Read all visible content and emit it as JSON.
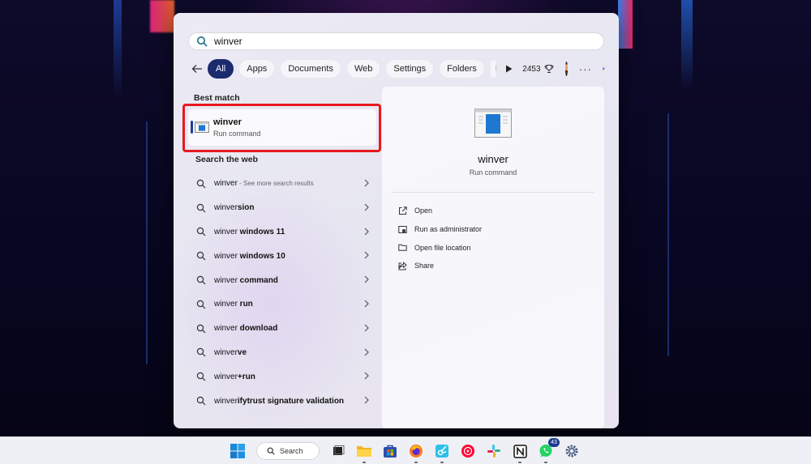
{
  "search": {
    "query": "winver"
  },
  "filters": {
    "tabs": [
      {
        "label": "All",
        "active": true
      },
      {
        "label": "Apps"
      },
      {
        "label": "Documents"
      },
      {
        "label": "Web"
      },
      {
        "label": "Settings"
      },
      {
        "label": "Folders"
      },
      {
        "label": "P"
      }
    ],
    "points": "2453"
  },
  "left": {
    "best_match_title": "Best match",
    "best_match": {
      "name": "winver",
      "subtitle": "Run command"
    },
    "web_title": "Search the web",
    "web_results": [
      {
        "prefix": "winver",
        "bold": "",
        "hint": " - See more search results"
      },
      {
        "prefix": "winver",
        "bold": "sion",
        "hint": ""
      },
      {
        "prefix": "winver",
        "bold": " windows 11",
        "hint": ""
      },
      {
        "prefix": "winver",
        "bold": " windows 10",
        "hint": ""
      },
      {
        "prefix": "winver",
        "bold": " command",
        "hint": ""
      },
      {
        "prefix": "winver",
        "bold": " run",
        "hint": ""
      },
      {
        "prefix": "winver",
        "bold": " download",
        "hint": ""
      },
      {
        "prefix": "winver",
        "bold": "ve",
        "hint": ""
      },
      {
        "prefix": "winver",
        "bold": "+run",
        "hint": ""
      },
      {
        "prefix": "winver",
        "bold": "ifytrust signature validation",
        "hint": ""
      }
    ]
  },
  "preview": {
    "title": "winver",
    "subtitle": "Run command",
    "actions": [
      {
        "label": "Open",
        "icon": "open-external-icon"
      },
      {
        "label": "Run as administrator",
        "icon": "shield-admin-icon"
      },
      {
        "label": "Open file location",
        "icon": "folder-icon"
      },
      {
        "label": "Share",
        "icon": "share-icon"
      }
    ]
  },
  "taskbar": {
    "search_label": "Search",
    "whatsapp_badge": "43",
    "apps": [
      "task-view",
      "file-explorer",
      "microsoft-store",
      "firefox",
      "snipping-tool",
      "youtube-music",
      "slack",
      "notion",
      "whatsapp",
      "settings"
    ]
  },
  "colors": {
    "accent": "#1c2a6e",
    "highlight": "#e8181e",
    "best_accent": "#1f3d9e"
  }
}
